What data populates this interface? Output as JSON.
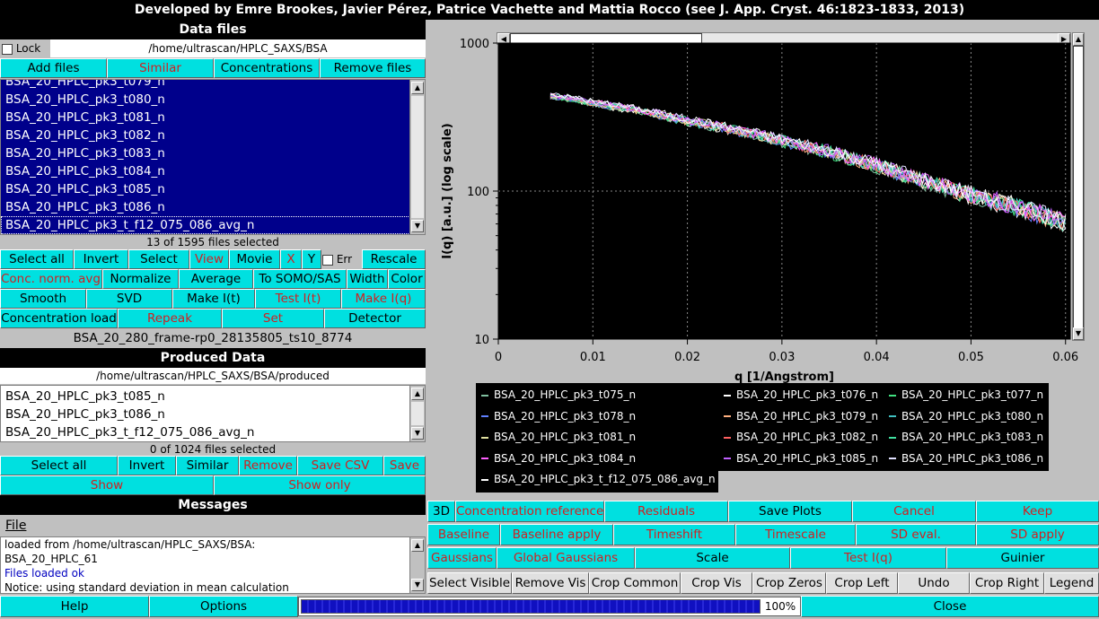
{
  "title": "Developed by Emre Brookes, Javier Pérez, Patrice Vachette and Mattia Rocco (see J. App. Cryst. 46:1823-1833, 2013)",
  "data_files": {
    "header": "Data files",
    "lock_label": "Lock",
    "path": "/home/ultrascan/HPLC_SAXS/BSA",
    "buttons": {
      "add": "Add files",
      "similar": "Similar",
      "concentrations": "Concentrations",
      "remove": "Remove files"
    },
    "items": [
      "BSA_20_HPLC_pk3_t079_n",
      "BSA_20_HPLC_pk3_t080_n",
      "BSA_20_HPLC_pk3_t081_n",
      "BSA_20_HPLC_pk3_t082_n",
      "BSA_20_HPLC_pk3_t083_n",
      "BSA_20_HPLC_pk3_t084_n",
      "BSA_20_HPLC_pk3_t085_n",
      "BSA_20_HPLC_pk3_t086_n",
      "BSA_20_HPLC_pk3_t_f12_075_086_avg_n"
    ],
    "status": "13 of 1595 files selected",
    "row1": {
      "select_all": "Select all",
      "invert": "Invert",
      "select": "Select",
      "view": "View",
      "movie": "Movie",
      "x": "X",
      "y": "Y",
      "err": "Err",
      "rescale": "Rescale"
    },
    "row2": {
      "conc_norm_avg": "Conc. norm. avg.",
      "normalize": "Normalize",
      "average": "Average",
      "to_somo": "To SOMO/SAS",
      "width": "Width",
      "color": "Color"
    },
    "row3": {
      "smooth": "Smooth",
      "svd": "SVD",
      "make_it": "Make I(t)",
      "test_it": "Test I(t)",
      "make_iq": "Make I(q)"
    },
    "row4": {
      "conc_load": "Concentration load",
      "repeak": "Repeak",
      "set": "Set",
      "detector": "Detector"
    },
    "frame_label": "BSA_20_280_frame-rp0_28135805_ts10_8774"
  },
  "produced": {
    "header": "Produced Data",
    "path": "/home/ultrascan/HPLC_SAXS/BSA/produced",
    "items": [
      "BSA_20_HPLC_pk3_t085_n",
      "BSA_20_HPLC_pk3_t086_n",
      "BSA_20_HPLC_pk3_t_f12_075_086_avg_n"
    ],
    "status": "0 of 1024 files selected",
    "row1": {
      "select_all": "Select all",
      "invert": "Invert",
      "similar": "Similar",
      "remove": "Remove",
      "save_csv": "Save CSV",
      "save": "Save"
    },
    "row2": {
      "show": "Show",
      "show_only": "Show only"
    }
  },
  "messages": {
    "header": "Messages",
    "menu_file": "File",
    "lines": [
      "loaded from /home/ultrascan/HPLC_SAXS/BSA:",
      "BSA_20_HPLC_61",
      "Files loaded ok",
      "Notice: using standard deviation in mean calculation"
    ],
    "ok_color": "#0000c0"
  },
  "bottom": {
    "help": "Help",
    "options": "Options",
    "progress": "100%",
    "progress_value": 1.0,
    "close": "Close"
  },
  "chart_data": {
    "type": "line",
    "xlabel": "q [1/Angstrom]",
    "ylabel": "I(q) [a.u.] (log scale)",
    "xlim": [
      0,
      0.0605
    ],
    "ylim": [
      10,
      1000
    ],
    "yscale": "log",
    "x_ticks": [
      "0",
      "0.01",
      "0.02",
      "0.03",
      "0.04",
      "0.05",
      "0.06"
    ],
    "y_ticks": [
      "10",
      "100",
      "1000"
    ],
    "grid": true,
    "curve_points": [
      {
        "q": 0.0055,
        "I": 440
      },
      {
        "q": 0.008,
        "I": 420
      },
      {
        "q": 0.01,
        "I": 395
      },
      {
        "q": 0.015,
        "I": 350
      },
      {
        "q": 0.02,
        "I": 300
      },
      {
        "q": 0.025,
        "I": 260
      },
      {
        "q": 0.03,
        "I": 220
      },
      {
        "q": 0.035,
        "I": 185
      },
      {
        "q": 0.04,
        "I": 150
      },
      {
        "q": 0.045,
        "I": 118
      },
      {
        "q": 0.05,
        "I": 95
      },
      {
        "q": 0.055,
        "I": 78
      },
      {
        "q": 0.06,
        "I": 62
      }
    ],
    "series": [
      {
        "name": "BSA_20_HPLC_pk3_t075_n",
        "color": "#80c0a0"
      },
      {
        "name": "BSA_20_HPLC_pk3_t076_n",
        "color": "#ffffff"
      },
      {
        "name": "BSA_20_HPLC_pk3_t077_n",
        "color": "#40e080"
      },
      {
        "name": "BSA_20_HPLC_pk3_t078_n",
        "color": "#6080ff"
      },
      {
        "name": "BSA_20_HPLC_pk3_t079_n",
        "color": "#ffb080"
      },
      {
        "name": "BSA_20_HPLC_pk3_t080_n",
        "color": "#40c0c0"
      },
      {
        "name": "BSA_20_HPLC_pk3_t081_n",
        "color": "#e0e0a0"
      },
      {
        "name": "BSA_20_HPLC_pk3_t082_n",
        "color": "#ff6060"
      },
      {
        "name": "BSA_20_HPLC_pk3_t083_n",
        "color": "#40e0a0"
      },
      {
        "name": "BSA_20_HPLC_pk3_t084_n",
        "color": "#ff60ff"
      },
      {
        "name": "BSA_20_HPLC_pk3_t085_n",
        "color": "#c060ff"
      },
      {
        "name": "BSA_20_HPLC_pk3_t086_n",
        "color": "#e0e0ff"
      },
      {
        "name": "BSA_20_HPLC_pk3_t_f12_075_086_avg_n",
        "color": "#ffffff"
      }
    ]
  },
  "right_buttons": {
    "row1": [
      "3D",
      "Concentration reference",
      "Residuals",
      "Save Plots",
      "Cancel",
      "Keep"
    ],
    "row2": [
      "Baseline",
      "Baseline apply",
      "Timeshift",
      "Timescale",
      "SD eval.",
      "SD apply"
    ],
    "row3": [
      "Gaussians",
      "Global Gaussians",
      "Scale",
      "Test I(q)",
      "Guinier"
    ],
    "row4": [
      "Select Visible",
      "Remove Vis",
      "Crop Common",
      "Crop Vis",
      "Crop Zeros",
      "Crop Left",
      "Undo",
      "Crop Right",
      "Legend"
    ]
  }
}
